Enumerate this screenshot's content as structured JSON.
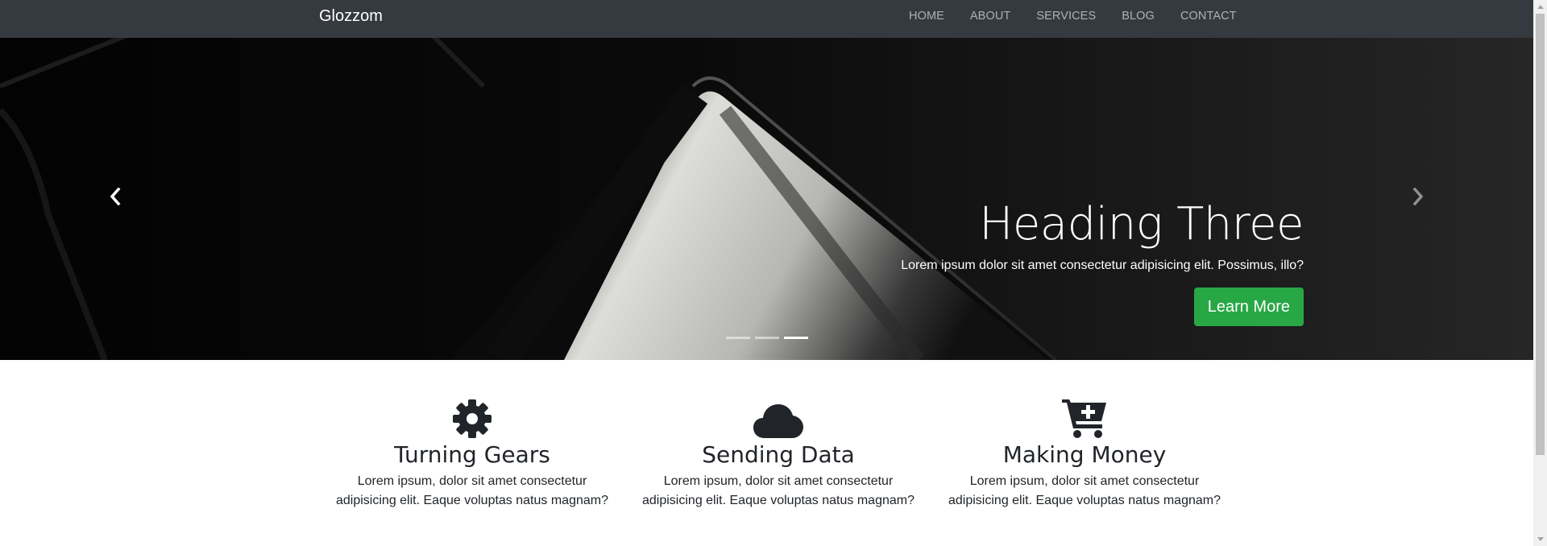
{
  "navbar": {
    "brand": "Glozzom",
    "links": [
      "HOME",
      "ABOUT",
      "SERVICES",
      "BLOG",
      "CONTACT"
    ]
  },
  "carousel": {
    "heading": "Heading Three",
    "text": "Lorem ipsum dolor sit amet consectetur adipisicing elit. Possimus, illo?",
    "button": "Learn More",
    "active_slide": 3,
    "slide_count": 3,
    "icons": {
      "prev": "chevron-left-icon",
      "next": "chevron-right-icon"
    }
  },
  "features": [
    {
      "icon": "gear-icon",
      "title": "Turning Gears",
      "text": "Lorem ipsum, dolor sit amet consectetur adipisicing elit. Eaque voluptas natus magnam?"
    },
    {
      "icon": "cloud-icon",
      "title": "Sending Data",
      "text": "Lorem ipsum, dolor sit amet consectetur adipisicing elit. Eaque voluptas natus magnam?"
    },
    {
      "icon": "cart-plus-icon",
      "title": "Making Money",
      "text": "Lorem ipsum, dolor sit amet consectetur adipisicing elit. Eaque voluptas natus magnam?"
    }
  ],
  "colors": {
    "navbar_bg": "#343a40",
    "button_bg": "#28a745",
    "text": "#212529"
  }
}
